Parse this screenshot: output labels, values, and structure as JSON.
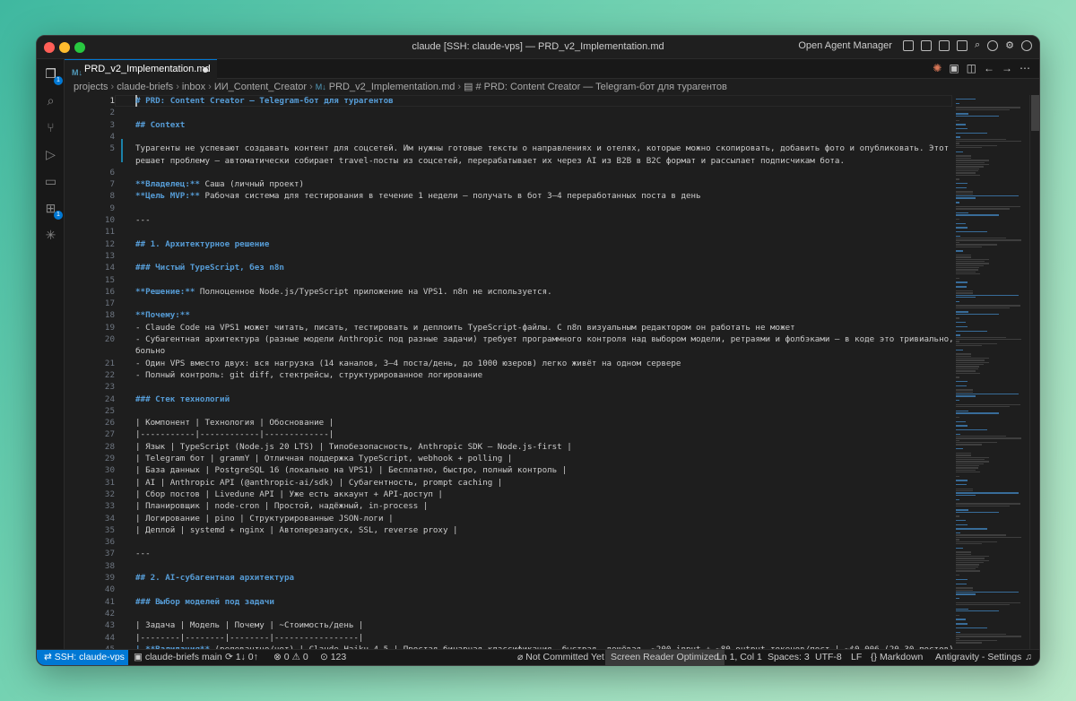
{
  "window": {
    "title": "claude [SSH: claude-vps] — PRD_v2_Implementation.md",
    "right_label": "Open Agent Manager"
  },
  "tab": {
    "label": "PRD_v2_Implementation.md",
    "icon": "markdown-icon",
    "dirty": true
  },
  "breadcrumb": {
    "parts": [
      "projects",
      "claude-briefs",
      "inbox",
      "ИИ_Content_Creator",
      "PRD_v2_Implementation.md",
      "# PRD: Content Creator — Telegram-бот для турагентов"
    ]
  },
  "activity_bar": {
    "items": [
      {
        "name": "explorer-icon",
        "badge": "1"
      },
      {
        "name": "search-icon"
      },
      {
        "name": "source-control-icon"
      },
      {
        "name": "run-debug-icon"
      },
      {
        "name": "remote-explorer-icon"
      },
      {
        "name": "extensions-icon",
        "badge": "1"
      },
      {
        "name": "claude-icon"
      }
    ]
  },
  "editor": {
    "lines": [
      {
        "n": "1",
        "t": "# PRD: Content Creator — Telegram-бот для турагентов",
        "h": true
      },
      {
        "n": "2",
        "t": ""
      },
      {
        "n": "3",
        "t": "## Context",
        "h": true
      },
      {
        "n": "4",
        "t": ""
      },
      {
        "n": "5",
        "t": "Турагенты не успевают создавать контент для соцсетей. Им нужны готовые тексты о направлениях и отелях, которые можно скопировать, добавить фото и опубликовать. Этот проект"
      },
      {
        "n": "",
        "t": "решает проблему — автоматически собирает travel-посты из соцсетей, перерабатывает их через AI из B2B в B2C формат и рассылает подписчикам бота."
      },
      {
        "n": "6",
        "t": ""
      },
      {
        "n": "7",
        "k": "**Владелец:**",
        "t": " Саша (личный проект)"
      },
      {
        "n": "8",
        "k": "**Цель MVP:**",
        "t": " Рабочая система для тестирования в течение 1 недели — получать в бот 3–4 переработанных поста в день"
      },
      {
        "n": "9",
        "t": ""
      },
      {
        "n": "10",
        "t": "---"
      },
      {
        "n": "11",
        "t": ""
      },
      {
        "n": "12",
        "t": "## 1. Архитектурное решение",
        "h": true
      },
      {
        "n": "13",
        "t": ""
      },
      {
        "n": "14",
        "t": "### Чистый TypeScript, без n8n",
        "h": true
      },
      {
        "n": "15",
        "t": ""
      },
      {
        "n": "16",
        "k": "**Решение:**",
        "t": " Полноценное Node.js/TypeScript приложение на VPS1. n8n не используется."
      },
      {
        "n": "17",
        "t": ""
      },
      {
        "n": "18",
        "k": "**Почему:**",
        "t": ""
      },
      {
        "n": "19",
        "t": "- Claude Code на VPS1 может читать, писать, тестировать и деплоить TypeScript-файлы. С n8n визуальным редактором он работать не может"
      },
      {
        "n": "20",
        "t": "- Субагентная архитектура (разные модели Anthropic под разные задачи) требует программного контроля над выбором модели, ретраями и фолбэками — в коде это тривиально, в n8n —"
      },
      {
        "n": "",
        "t": "больно"
      },
      {
        "n": "21",
        "t": "- Один VPS вместо двух: вся нагрузка (14 каналов, 3–4 поста/день, до 1000 юзеров) легко живёт на одном сервере"
      },
      {
        "n": "22",
        "t": "- Полный контроль: git diff, стектрейсы, структурированное логирование"
      },
      {
        "n": "23",
        "t": ""
      },
      {
        "n": "24",
        "t": "### Стек технологий",
        "h": true
      },
      {
        "n": "25",
        "t": ""
      },
      {
        "n": "26",
        "t": "| Компонент | Технология | Обоснование |"
      },
      {
        "n": "27",
        "t": "|-----------|------------|-------------|"
      },
      {
        "n": "28",
        "t": "| Язык | TypeScript (Node.js 20 LTS) | Типобезопасность, Anthropic SDK — Node.js-first |"
      },
      {
        "n": "29",
        "t": "| Telegram бот | grammY | Отличная поддержка TypeScript, webhook + polling |"
      },
      {
        "n": "30",
        "t": "| База данных | PostgreSQL 16 (локально на VPS1) | Бесплатно, быстро, полный контроль |"
      },
      {
        "n": "31",
        "t": "| AI | Anthropic API (@anthropic-ai/sdk) | Субагентность, prompt caching |"
      },
      {
        "n": "32",
        "t": "| Сбор постов | Livedune API | Уже есть аккаунт + API-доступ |"
      },
      {
        "n": "33",
        "t": "| Планировщик | node-cron | Простой, надёжный, in-process |"
      },
      {
        "n": "34",
        "t": "| Логирование | pino | Структурированные JSON-логи |"
      },
      {
        "n": "35",
        "t": "| Деплой | systemd + nginx | Автоперезапуск, SSL, reverse proxy |"
      },
      {
        "n": "36",
        "t": ""
      },
      {
        "n": "37",
        "t": "---"
      },
      {
        "n": "38",
        "t": ""
      },
      {
        "n": "39",
        "t": "## 2. AI-субагентная архитектура",
        "h": true
      },
      {
        "n": "40",
        "t": ""
      },
      {
        "n": "41",
        "t": "### Выбор моделей под задачи",
        "h": true
      },
      {
        "n": "42",
        "t": ""
      },
      {
        "n": "43",
        "t": "| Задача | Модель | Почему | ~Стоимость/день |"
      },
      {
        "n": "44",
        "t": "|--------|--------|--------|-----------------|"
      },
      {
        "n": "45",
        "k": "| **Валидация**",
        "t": " (релевантно/нет) | Claude Haiku 4.5 | Простая бинарная классификация, быстрая, дешёвая. ~200 input + ~80 output токенов/пост | ~$0.006 (20–30 постов) |"
      }
    ]
  },
  "statusbar": {
    "remote": "SSH: claude-vps",
    "repo": "claude-briefs",
    "branch": "main",
    "sync": "1↓ 0↑",
    "errors": "0",
    "warnings": "0",
    "ports": "123",
    "commit_status": "Not Committed Yet",
    "screen_reader": "Screen Reader Optimized",
    "position": "Ln 1, Col 1",
    "spaces": "Spaces: 3",
    "encoding": "UTF-8",
    "eol": "LF",
    "language": "Markdown",
    "settings": "Antigravity - Settings"
  }
}
